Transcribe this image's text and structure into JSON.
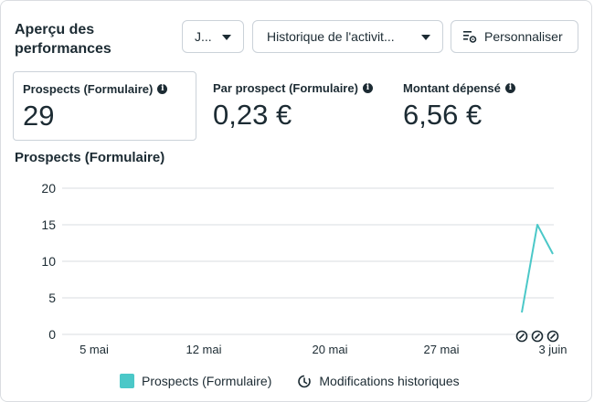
{
  "header": {
    "title": "Aperçu des performances",
    "date_button": "J...",
    "history_button": "Historique de l'activit...",
    "customize_button": "Personnaliser"
  },
  "metrics": [
    {
      "label": "Prospects (Formulaire)",
      "value": "29"
    },
    {
      "label": "Par prospect (Formulaire)",
      "value": "0,23 €"
    },
    {
      "label": "Montant dépensé",
      "value": "6,56 €"
    }
  ],
  "chart_title": "Prospects (Formulaire)",
  "legend": {
    "series": "Prospects (Formulaire)",
    "history": "Modifications historiques"
  },
  "colors": {
    "series": "#4bc8c8",
    "grid": "#dadde1"
  },
  "chart_data": {
    "type": "line",
    "ylim": [
      0,
      20
    ],
    "yticks": [
      "20",
      "15",
      "10",
      "5",
      "0"
    ],
    "xticks": [
      "5 mai",
      "12 mai",
      "20 mai",
      "27 mai",
      "3 juin"
    ],
    "series": [
      {
        "name": "Prospects (Formulaire)",
        "x_days_from_5mai": [
          27,
          28,
          29
        ],
        "values": [
          3,
          15,
          11
        ]
      }
    ],
    "history_markers_days_from_5mai": [
      27,
      28,
      29
    ]
  }
}
